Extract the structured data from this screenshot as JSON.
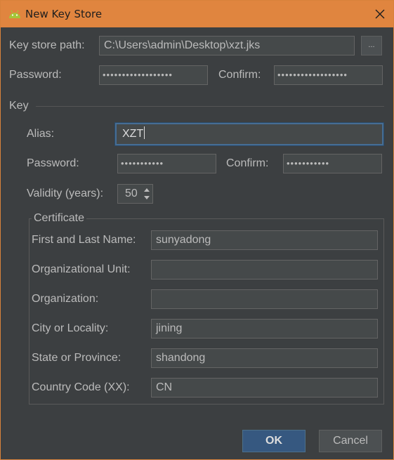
{
  "window": {
    "title": "New Key Store",
    "icon": "android-icon",
    "close_icon": "close-icon"
  },
  "keystore": {
    "path_label": "Key store path:",
    "path_value": "C:\\Users\\admin\\Desktop\\xzt.jks",
    "browse_label": "...",
    "password_label": "Password:",
    "password_value": "••••••••••••••••••",
    "confirm_label": "Confirm:",
    "confirm_value": "••••••••••••••••••"
  },
  "key": {
    "section_label": "Key",
    "alias_label": "Alias:",
    "alias_value": "XZT",
    "password_label": "Password:",
    "password_value": "•••••••••••",
    "confirm_label": "Confirm:",
    "confirm_value": "•••••••••••",
    "validity_label": "Validity (years):",
    "validity_value": "50"
  },
  "certificate": {
    "title": "Certificate",
    "fields": [
      {
        "label": "First and Last Name:",
        "value": "sunyadong"
      },
      {
        "label": "Organizational Unit:",
        "value": ""
      },
      {
        "label": "Organization:",
        "value": ""
      },
      {
        "label": "City or Locality:",
        "value": "jining"
      },
      {
        "label": "State or Province:",
        "value": "shandong"
      },
      {
        "label": "Country Code (XX):",
        "value": "CN"
      }
    ]
  },
  "buttons": {
    "ok": "OK",
    "cancel": "Cancel"
  },
  "colors": {
    "title_bar": "#e0853f",
    "background": "#3c3f41",
    "primary_button": "#365880",
    "focus_border": "#466d94"
  }
}
